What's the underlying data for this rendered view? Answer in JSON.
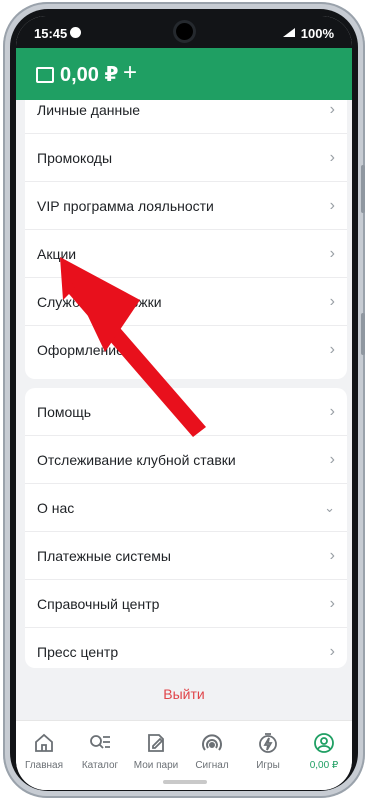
{
  "status_bar": {
    "time": "15:45",
    "battery": "100%"
  },
  "header": {
    "balance": "0,00 ₽",
    "add_label": "+"
  },
  "menu_group_1": [
    {
      "label": "Личные данные",
      "icon": "chevron-right-icon"
    },
    {
      "label": "Промокоды",
      "icon": "chevron-right-icon"
    },
    {
      "label": "VIP программа лояльности",
      "icon": "chevron-right-icon"
    },
    {
      "label": "Акции",
      "icon": "chevron-right-icon"
    },
    {
      "label": "Служба поддержки",
      "icon": "chevron-right-icon"
    },
    {
      "label": "Оформление",
      "icon": "chevron-right-icon"
    }
  ],
  "menu_group_2": [
    {
      "label": "Помощь",
      "icon": "chevron-right-icon"
    },
    {
      "label": "Отслеживание клубной ставки",
      "icon": "chevron-right-icon"
    },
    {
      "label": "О нас",
      "icon": "chevron-down-icon"
    },
    {
      "label": "Платежные системы",
      "icon": "chevron-right-icon"
    },
    {
      "label": "Справочный центр",
      "icon": "chevron-right-icon"
    },
    {
      "label": "Пресс центр",
      "icon": "chevron-right-icon"
    }
  ],
  "logout_label": "Выйти",
  "bottom_nav": [
    {
      "label": "Главная",
      "icon": "home-icon"
    },
    {
      "label": "Каталог",
      "icon": "catalog-search-icon"
    },
    {
      "label": "Мои пари",
      "icon": "bet-ticket-icon"
    },
    {
      "label": "Сигнал",
      "icon": "signal-icon"
    },
    {
      "label": "Игры",
      "icon": "games-bolt-icon"
    },
    {
      "label": "0,00 ₽",
      "icon": "profile-icon",
      "active": true
    }
  ],
  "colors": {
    "brand_green": "#1f9f63",
    "logout_red": "#e0454a",
    "annotation_arrow": "#e8101c"
  }
}
